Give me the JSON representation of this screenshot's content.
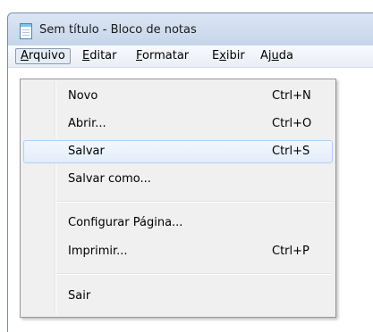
{
  "window": {
    "title": "Sem título - Bloco de notas"
  },
  "menubar": {
    "items": [
      {
        "label": "Arquivo",
        "mnemonic": "A",
        "rest": "rquivo"
      },
      {
        "label": "Editar",
        "mnemonic": "E",
        "rest": "ditar"
      },
      {
        "label": "Formatar",
        "mnemonic": "F",
        "rest": "ormatar"
      },
      {
        "label": "Exibir",
        "pre": "E",
        "mnemonic": "x",
        "rest": "ibir"
      },
      {
        "label": "Ajuda",
        "pre": "Aj",
        "mnemonic": "u",
        "rest": "da"
      }
    ]
  },
  "dropdown": {
    "items": [
      {
        "label": "Novo",
        "shortcut": "Ctrl+N"
      },
      {
        "label": "Abrir...",
        "shortcut": "Ctrl+O"
      },
      {
        "label": "Salvar",
        "shortcut": "Ctrl+S",
        "highlighted": true
      },
      {
        "label": "Salvar como...",
        "shortcut": ""
      },
      {
        "label": "Configurar Página...",
        "shortcut": ""
      },
      {
        "label": "Imprimir...",
        "shortcut": "Ctrl+P"
      },
      {
        "label": "Sair",
        "shortcut": ""
      }
    ]
  }
}
